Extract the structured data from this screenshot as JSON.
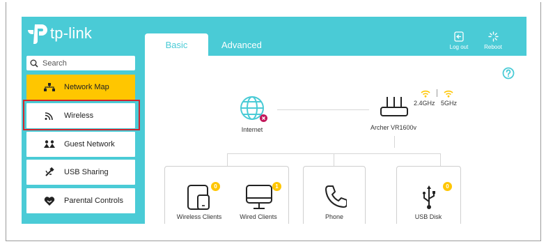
{
  "brand": {
    "name": "tp-link"
  },
  "search": {
    "placeholder": "Search"
  },
  "sidebar": {
    "items": [
      {
        "label": "Network Map",
        "icon": "network-map-icon",
        "active": true
      },
      {
        "label": "Wireless",
        "icon": "wireless-icon",
        "highlighted": true
      },
      {
        "label": "Guest Network",
        "icon": "guest-network-icon"
      },
      {
        "label": "USB Sharing",
        "icon": "usb-sharing-icon"
      },
      {
        "label": "Parental Controls",
        "icon": "parental-controls-icon"
      }
    ]
  },
  "tabs": [
    {
      "label": "Basic",
      "active": true
    },
    {
      "label": "Advanced"
    }
  ],
  "header": {
    "logout_label": "Log out",
    "reboot_label": "Reboot"
  },
  "map": {
    "internet_label": "Internet",
    "router_label": "Archer VR1600v",
    "band_24": "2.4GHz",
    "band_5": "5GHz",
    "devices": [
      {
        "label": "Wireless Clients",
        "count": "0"
      },
      {
        "label": "Wired Clients",
        "count": "1"
      },
      {
        "label": "Phone"
      },
      {
        "label": "USB Disk",
        "count": "0"
      }
    ]
  },
  "colors": {
    "brand_teal": "#4acbd6",
    "active_yellow": "#ffc600",
    "highlight_red": "#d0242d",
    "error_pink": "#c2185b"
  }
}
